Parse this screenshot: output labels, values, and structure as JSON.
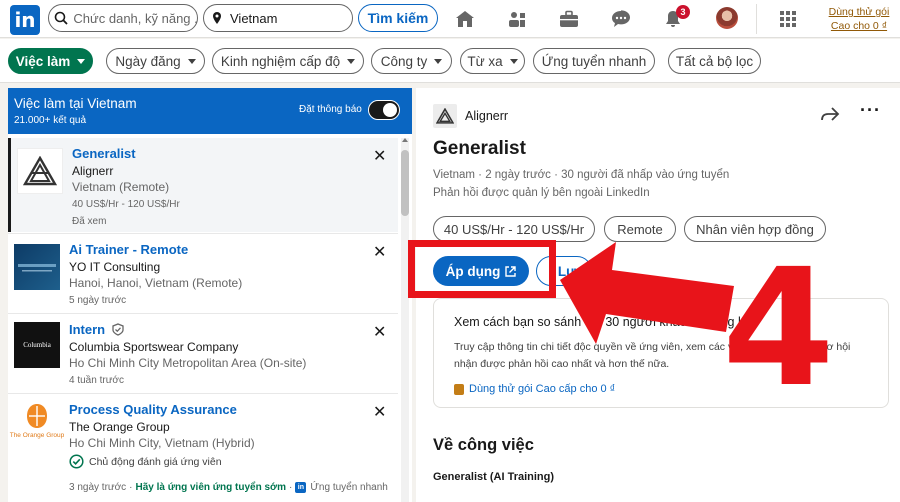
{
  "topnav": {
    "logo": "in",
    "search_placeholder": "Chức danh, kỹ năng ...",
    "location_value": "Vietnam",
    "search_button": "Tìm kiếm",
    "notification_count": "3",
    "premium_link": "Dùng thử gói Cao cho 0 ₫"
  },
  "filters": [
    {
      "label": "Việc làm"
    },
    {
      "label": "Ngày đăng"
    },
    {
      "label": "Kinh nghiệm cấp độ"
    },
    {
      "label": "Công ty"
    },
    {
      "label": "Từ xa"
    },
    {
      "label": "Ứng tuyển nhanh"
    },
    {
      "label": "Tất cả bộ lọc"
    }
  ],
  "left_panel": {
    "title": "Việc làm tại Vietnam",
    "count": "21.000+ kết quả",
    "alert_label": "Đặt thông báo",
    "jobs": [
      {
        "title": "Generalist",
        "company": "Alignerr",
        "location": "Vietnam (Remote)",
        "salary": "40 US$/Hr - 120 US$/Hr",
        "status": "Đã xem"
      },
      {
        "title": "Ai Trainer - Remote",
        "company": "YO IT Consulting",
        "location": "Hanoi, Hanoi, Vietnam (Remote)",
        "time": "5 ngày trước"
      },
      {
        "title": "Intern",
        "company": "Columbia Sportswear Company",
        "location": "Ho Chi Minh City Metropolitan Area (On-site)",
        "time": "4 tuần trước",
        "logo_text": "Columbia"
      },
      {
        "title": "Process Quality Assurance",
        "company": "The Orange Group",
        "location": "Ho Chi Minh City, Vietnam (Hybrid)",
        "insight": "Chủ động đánh giá ứng viên",
        "time": "3 ngày trước",
        "early": "Hãy là ứng viên ứng tuyển sớm",
        "easy_apply": "Ứng tuyển nhanh",
        "logo_text": "The Orange Group"
      }
    ]
  },
  "right_panel": {
    "company": "Alignerr",
    "title": "Generalist",
    "meta": "Vietnam · 2 ngày trước · 30 người đã nhấp vào ứng tuyển",
    "meta2": "Phản hồi được quản lý bên ngoài LinkedIn",
    "tags": [
      "40 US$/Hr - 120 US$/Hr",
      "Remote",
      "Nhân viên hợp đồng"
    ],
    "apply_label": "Áp dụng",
    "save_label": "Lưu",
    "premium": {
      "title": "Xem cách bạn so sánh với 30 người khác đã đăng ký",
      "body": "Truy cập thông tin chi tiết độc quyền về ứng viên, xem các việc làm mà bạn có cơ hội nhận được phản hồi cao nhất và hơn thế nữa.",
      "link": "Dùng thử gói Cao cấp cho 0 ₫"
    },
    "about_title": "Về công việc",
    "about_sub": "Generalist (AI Training)"
  },
  "annotation": {
    "step_number": "4",
    "color": "#e8141a"
  }
}
